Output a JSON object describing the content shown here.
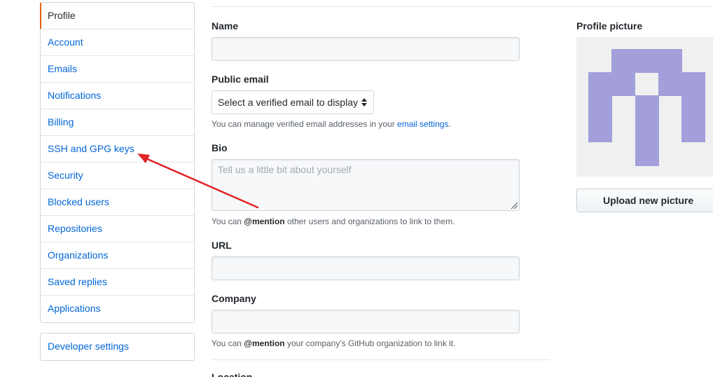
{
  "sidebar": {
    "items": [
      {
        "label": "Profile"
      },
      {
        "label": "Account"
      },
      {
        "label": "Emails"
      },
      {
        "label": "Notifications"
      },
      {
        "label": "Billing"
      },
      {
        "label": "SSH and GPG keys"
      },
      {
        "label": "Security"
      },
      {
        "label": "Blocked users"
      },
      {
        "label": "Repositories"
      },
      {
        "label": "Organizations"
      },
      {
        "label": "Saved replies"
      },
      {
        "label": "Applications"
      }
    ],
    "developer_settings": "Developer settings"
  },
  "form": {
    "name": {
      "label": "Name",
      "value": ""
    },
    "public_email": {
      "label": "Public email",
      "selected": "Select a verified email to display",
      "note_prefix": "You can manage verified email addresses in your ",
      "note_link": "email settings",
      "note_suffix": "."
    },
    "bio": {
      "label": "Bio",
      "placeholder": "Tell us a little bit about yourself",
      "note_prefix": "You can ",
      "note_mention": "@mention",
      "note_suffix": " other users and organizations to link to them."
    },
    "url": {
      "label": "URL",
      "value": ""
    },
    "company": {
      "label": "Company",
      "value": "",
      "note_prefix": "You can ",
      "note_mention": "@mention",
      "note_suffix": " your company's GitHub organization to link it."
    },
    "location": {
      "label": "Location"
    }
  },
  "profile_picture": {
    "label": "Profile picture",
    "upload_label": "Upload new picture",
    "identicon_color": "#a29fdb"
  },
  "colors": {
    "link": "#0366d6",
    "selected_accent": "#e36209",
    "annotation_arrow": "#e02424"
  }
}
